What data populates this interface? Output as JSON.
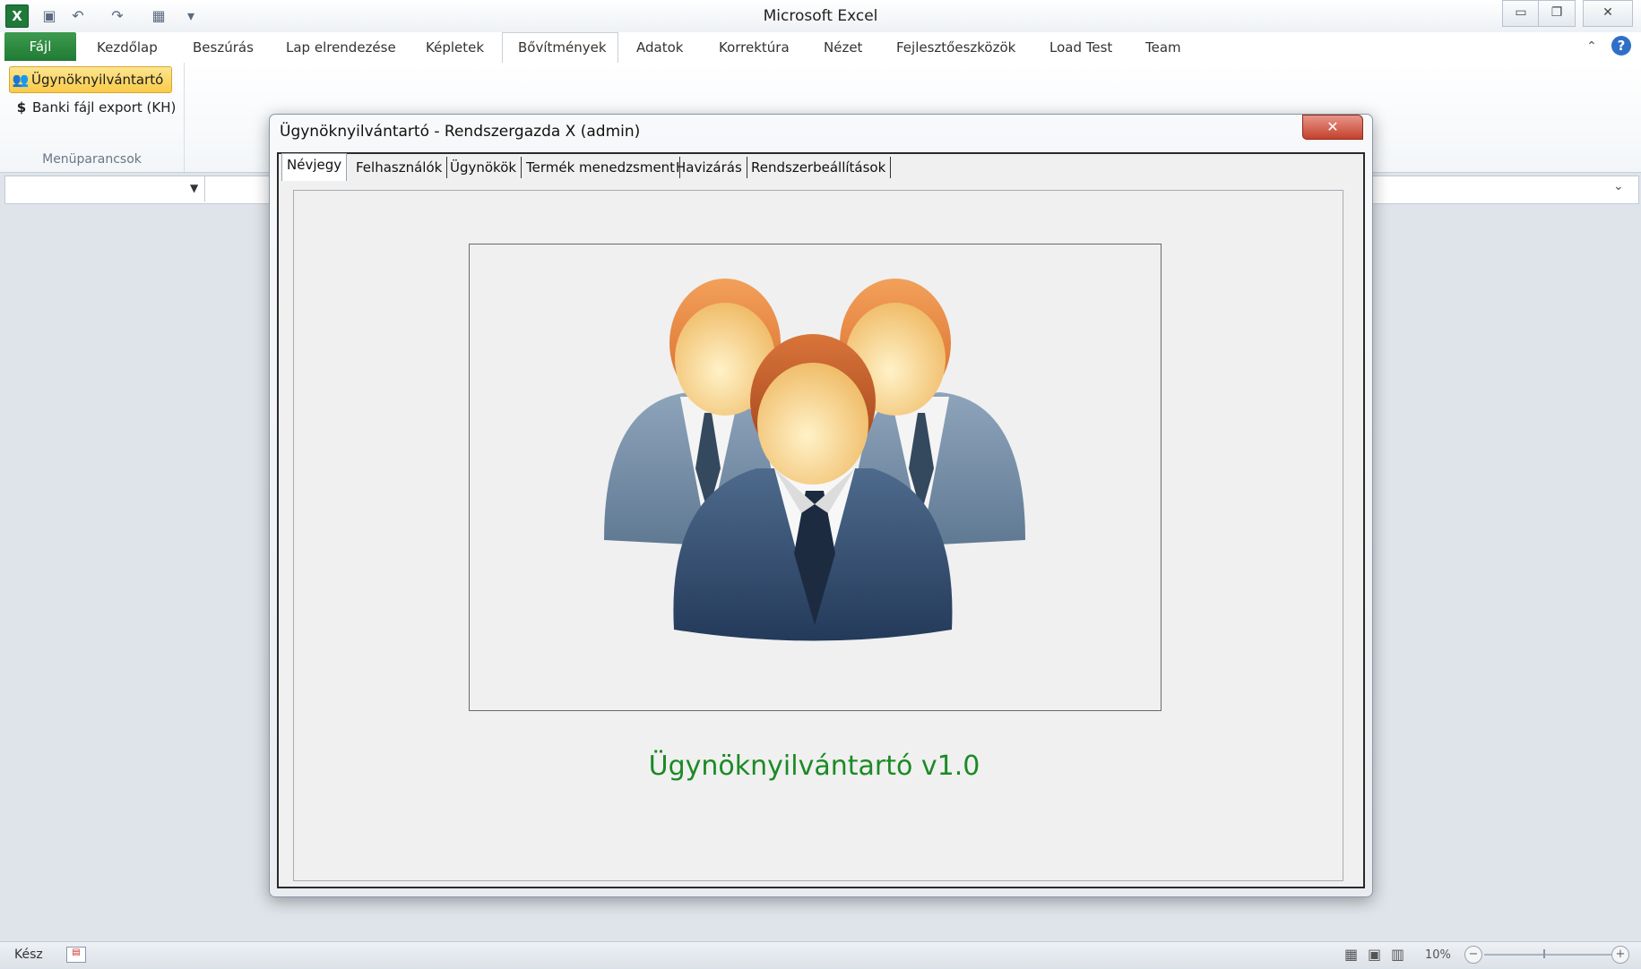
{
  "window": {
    "title": "Microsoft Excel",
    "qat": [
      "excel-icon",
      "save-icon",
      "undo-icon",
      "redo-icon",
      "form-icon",
      "customize-icon"
    ],
    "buttons": {
      "minimize": "▭",
      "restore": "❐",
      "close": "✕"
    }
  },
  "ribbon": {
    "file_tab": "Fájl",
    "tabs": [
      "Kezdőlap",
      "Beszúrás",
      "Lap elrendezése",
      "Képletek",
      "Bővítmények",
      "Adatok",
      "Korrektúra",
      "Nézet",
      "Fejlesztőeszközök",
      "Load Test",
      "Team"
    ],
    "active_tab": "Bővítmények",
    "group": {
      "label": "Menüparancsok",
      "items": [
        {
          "label": "Ügynöknyilvántartó",
          "icon": "users-icon"
        },
        {
          "label": "Banki fájl export (KH)",
          "icon": "dollar-icon"
        }
      ]
    }
  },
  "statusbar": {
    "status": "Kész",
    "zoom": "10%"
  },
  "dialog": {
    "title": "Ügynöknyilvántartó - Rendszergazda X (admin)",
    "close": "✕",
    "tabs": [
      "Névjegy",
      "Felhasználók",
      "Ügynökök",
      "Termék menedzsment",
      "Havizárás",
      "Rendszerbeállítások"
    ],
    "active_tab": "Névjegy",
    "version_text": "Ügynöknyilvántartó v1.0"
  },
  "colors": {
    "excel_green": "#1f7a3a",
    "version_green": "#1b8a24",
    "close_red": "#c4402d"
  }
}
